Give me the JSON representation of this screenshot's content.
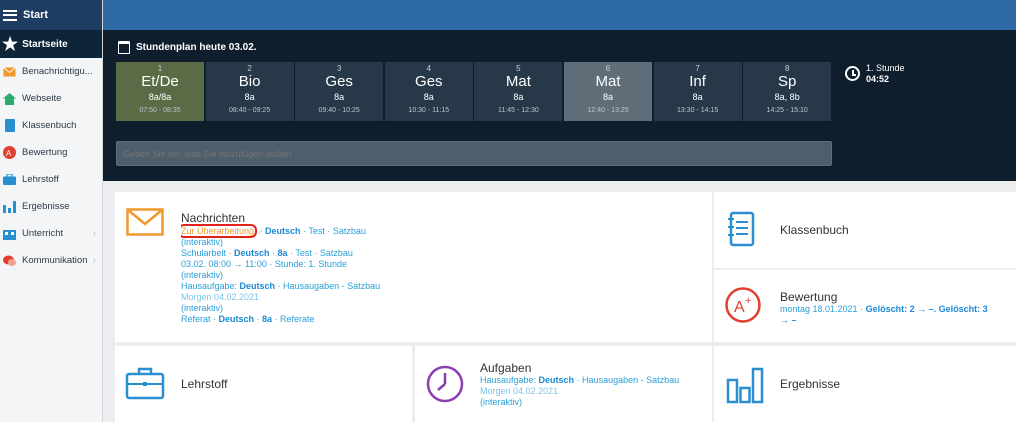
{
  "header": {
    "title": "Start"
  },
  "sidebar": {
    "active": "Startseite",
    "items": [
      {
        "label": "Benachrichtigu...",
        "icon": "envelope-icon",
        "color": "#f0972e",
        "chevron": false
      },
      {
        "label": "Webseite",
        "icon": "home-icon",
        "color": "#2bab6f",
        "chevron": false
      },
      {
        "label": "Klassenbuch",
        "icon": "notebook-icon",
        "color": "#2a8fd1",
        "chevron": false
      },
      {
        "label": "Bewertung",
        "icon": "grade-icon",
        "color": "#e0412e",
        "chevron": false
      },
      {
        "label": "Lehrstoff",
        "icon": "briefcase-icon",
        "color": "#2a8fd1",
        "chevron": false
      },
      {
        "label": "Ergebnisse",
        "icon": "bar-chart-icon",
        "color": "#2a8fd1",
        "chevron": false
      },
      {
        "label": "Unterricht",
        "icon": "school-icon",
        "color": "#2a8fd1",
        "chevron": true
      },
      {
        "label": "Kommunikation",
        "icon": "chat-icon",
        "color": "#e0412e",
        "chevron": true
      }
    ]
  },
  "timetable": {
    "title": "Stundenplan heute 03.02.",
    "lessons": [
      {
        "num": "1",
        "subject": "Et/De",
        "class": "8a/8a",
        "time": "07:50 - 08:35",
        "state": "past"
      },
      {
        "num": "2",
        "subject": "Bio",
        "class": "8a",
        "time": "08:40 - 09:25",
        "state": ""
      },
      {
        "num": "3",
        "subject": "Ges",
        "class": "8a",
        "time": "09:40 - 10:25",
        "state": ""
      },
      {
        "num": "4",
        "subject": "Ges",
        "class": "8a",
        "time": "10:30 - 11:15",
        "state": ""
      },
      {
        "num": "5",
        "subject": "Mat",
        "class": "8a",
        "time": "11:45 - 12:30",
        "state": ""
      },
      {
        "num": "6",
        "subject": "Mat",
        "class": "8a",
        "time": "12:40 - 13:25",
        "state": "cur"
      },
      {
        "num": "7",
        "subject": "Inf",
        "class": "8a",
        "time": "13:30 - 14:15",
        "state": ""
      },
      {
        "num": "8",
        "subject": "Sp",
        "class": "8a, 8b",
        "time": "14:25 - 15:10",
        "state": ""
      }
    ],
    "clock": {
      "label": "1. Stunde",
      "value": "04:52"
    },
    "input_placeholder": "Geben Sie ein, was Sie hinzufügen wollen"
  },
  "tiles": {
    "nachrichten": {
      "title": "Nachrichten",
      "l1_status": "Zur Überarbeitung",
      "l1_dot": " · ",
      "l1_subject": "Deutsch",
      "l1_rest": " · Test · Satzbau",
      "l2": "(interaktiv)",
      "l3_prefix": "Schularbeit · ",
      "l3_subject": "Deutsch",
      "l3_sep": " · ",
      "l3_class": "8a",
      "l3_rest": " · Test · Satzbau",
      "l4": "03.02. 08:00 → 11:00 · Stunde: 1. Stunde",
      "l5": "(interaktiv)",
      "l6_prefix": "Hausaufgabe: ",
      "l6_subject": "Deutsch",
      "l6_rest": " · Hausaugaben - Satzbau",
      "l7": "Morgen 04.02.2021",
      "l8": "(interaktiv)",
      "l9_prefix": "Referat · ",
      "l9_subject": "Deutsch",
      "l9_sep": " · ",
      "l9_class": "8a",
      "l9_rest": " · Referate"
    },
    "klassenbuch": {
      "title": "Klassenbuch"
    },
    "bewertung": {
      "title": "Bewertung",
      "date": "montag 18.01.2021 · ",
      "change1": "Gelöscht: 2 → –.",
      "change2": " Gelöscht: 3",
      "arrow": "→ –"
    },
    "lehrstoff": {
      "title": "Lehrstoff"
    },
    "aufgaben": {
      "title": "Aufgaben",
      "l1_prefix": "Hausaufgabe: ",
      "l1_subject": "Deutsch",
      "l1_rest": " · Hausaugaben - Satzbau",
      "l2": "Morgen 04.02.2021",
      "l3": "(interaktiv)"
    },
    "ergebnisse": {
      "title": "Ergebnisse"
    }
  },
  "colors": {
    "topbar": "#2e6aa5",
    "timetable_bg": "#0f1e2c",
    "link": "#2a9fd8",
    "orange": "#f0972e",
    "purple": "#8c3db0"
  }
}
